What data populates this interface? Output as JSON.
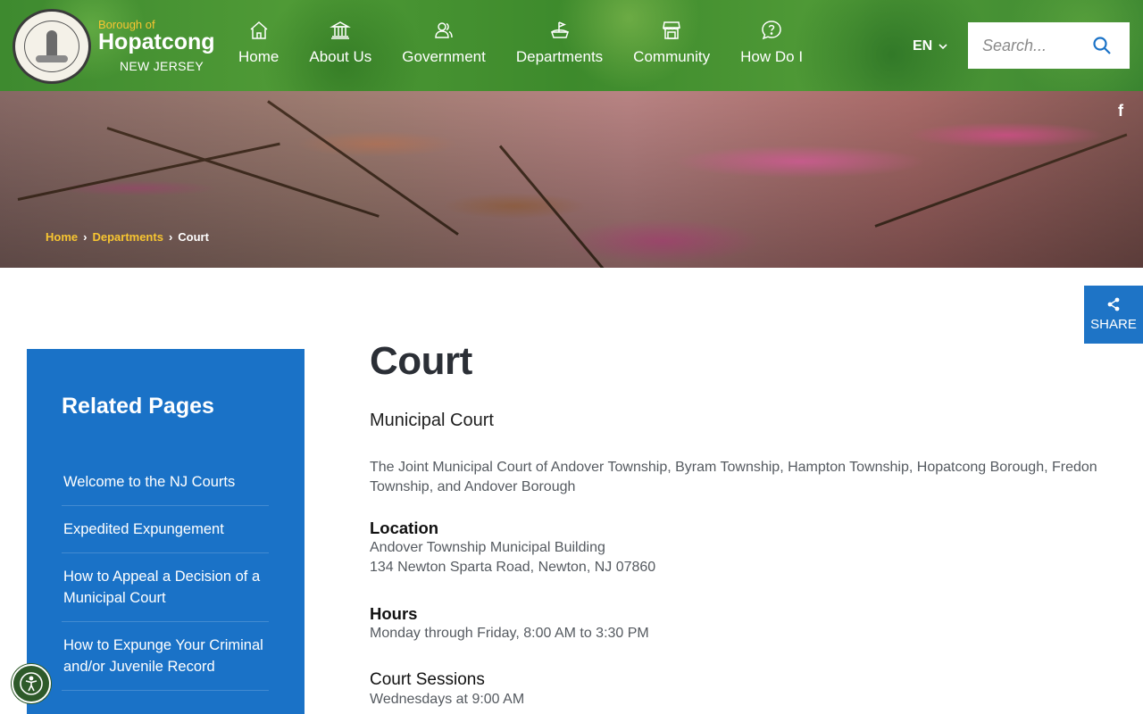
{
  "brand": {
    "pre": "Borough of",
    "name": "Hopatcong",
    "sub": "NEW JERSEY",
    "seal_icon": "borough-seal"
  },
  "nav": {
    "items": [
      {
        "label": "Home",
        "icon": "home-icon"
      },
      {
        "label": "About Us",
        "icon": "building-icon"
      },
      {
        "label": "Government",
        "icon": "people-icon"
      },
      {
        "label": "Departments",
        "icon": "flag-icon"
      },
      {
        "label": "Community",
        "icon": "storefront-icon"
      },
      {
        "label": "How Do I",
        "icon": "question-icon"
      }
    ]
  },
  "language": {
    "label": "EN",
    "icon": "chevron-down-icon"
  },
  "search": {
    "placeholder": "Search...",
    "icon": "search-icon"
  },
  "breadcrumb": {
    "items": [
      {
        "label": "Home"
      },
      {
        "label": "Departments"
      }
    ],
    "separator": "›",
    "current": "Court"
  },
  "social": {
    "facebook": "f"
  },
  "share": {
    "label": "SHARE",
    "icon": "share-icon"
  },
  "sidebar": {
    "title": "Related Pages",
    "items": [
      {
        "label": "Welcome to the NJ Courts"
      },
      {
        "label": "Expedited Expungement"
      },
      {
        "label": "How to Appeal a Decision of a Municipal Court"
      },
      {
        "label": "How to Expunge Your Criminal and/or Juvenile Record"
      }
    ]
  },
  "main": {
    "title": "Court",
    "subheading": "Municipal Court",
    "intro": "The Joint Municipal Court of Andover Township, Byram Township, Hampton Township, Hopatcong Borough, Fredon Township, and Andover Borough",
    "location": {
      "title": "Location",
      "line1": "Andover Township Municipal Building",
      "line2": "134 Newton Sparta Road, Newton, NJ 07860"
    },
    "hours": {
      "title": "Hours",
      "line1": "Monday through Friday, 8:00 AM to 3:30 PM"
    },
    "sessions": {
      "title": "Court Sessions",
      "line1": "Wednesdays at 9:00 AM"
    }
  },
  "colors": {
    "header_green": "#4a9435",
    "accent_blue": "#1a72c7",
    "breadcrumb_gold": "#f7c531",
    "title_dark": "#2b2f36",
    "a11y_green": "#2e5a2a"
  }
}
